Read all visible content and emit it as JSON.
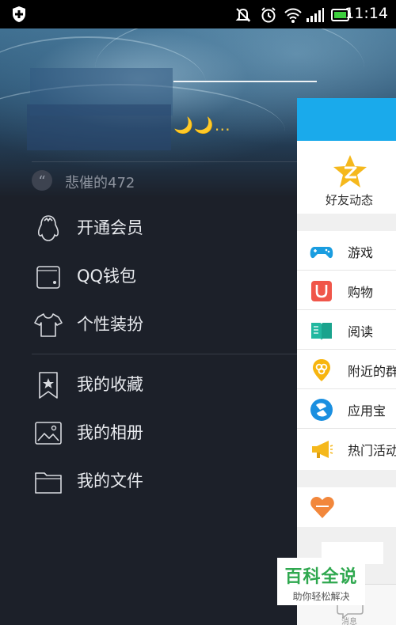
{
  "status_bar": {
    "time": "11:14",
    "icons": [
      "shield-plus-icon",
      "mute-icon",
      "alarm-icon",
      "wifi-icon",
      "signal-icon",
      "battery-icon"
    ]
  },
  "profile": {
    "name_decoration": "🌙🌙…",
    "signature": "悲催的472"
  },
  "menu": {
    "items": [
      {
        "label": "开通会员",
        "icon": "penguin-icon"
      },
      {
        "label": "QQ钱包",
        "icon": "wallet-icon"
      },
      {
        "label": "个性装扮",
        "icon": "tshirt-icon"
      },
      {
        "label": "我的收藏",
        "icon": "bookmark-star-icon"
      },
      {
        "label": "我的相册",
        "icon": "photo-icon"
      },
      {
        "label": "我的文件",
        "icon": "folder-icon"
      }
    ]
  },
  "peek_panel": {
    "header_color": "#1aaaeb",
    "friend_feed_label": "好友动态",
    "list": [
      {
        "label": "游戏",
        "icon": "gamepad-icon"
      },
      {
        "label": "购物",
        "icon": "magnet-shop-icon"
      },
      {
        "label": "阅读",
        "icon": "book-icon"
      },
      {
        "label": "附近的群",
        "icon": "nearby-group-icon"
      },
      {
        "label": "应用宝",
        "icon": "appstore-icon"
      },
      {
        "label": "热门活动",
        "icon": "megaphone-icon"
      }
    ],
    "bottom_tab_label": "消息"
  },
  "watermark": {
    "title": "百科全说",
    "subtitle": "助你轻松解决"
  }
}
